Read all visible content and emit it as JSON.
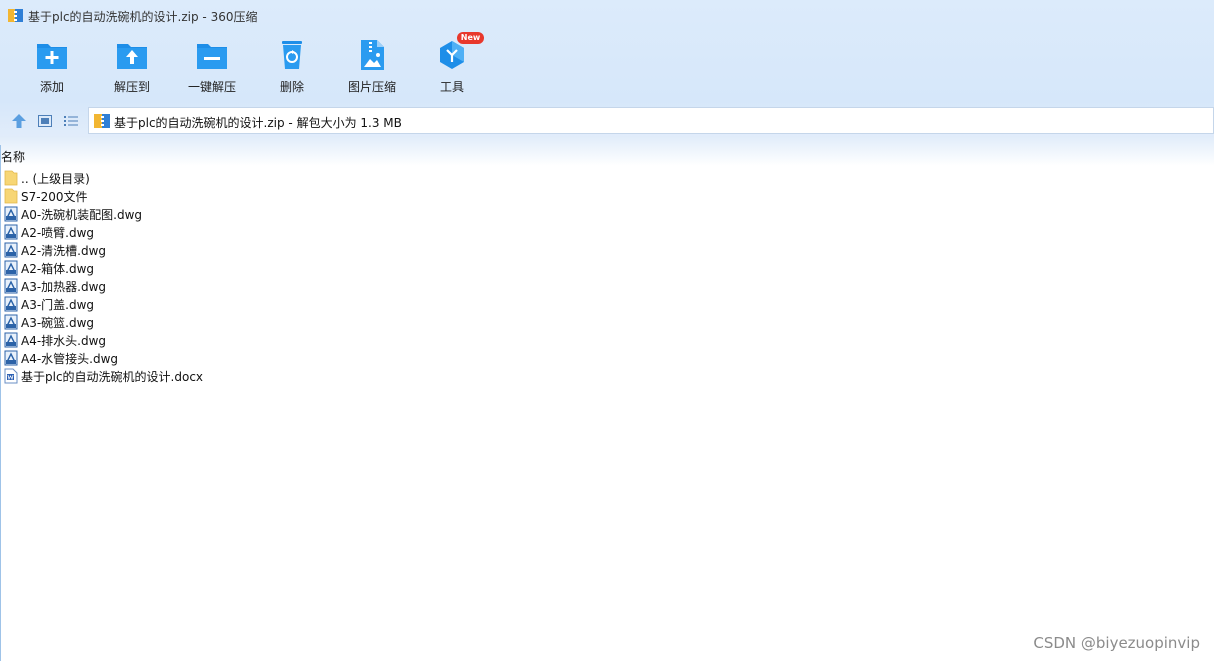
{
  "window": {
    "title": "基于plc的自动洗碗机的设计.zip - 360压缩"
  },
  "toolbar": {
    "buttons": [
      {
        "label": "添加",
        "icon": "add-folder-icon"
      },
      {
        "label": "解压到",
        "icon": "extract-to-icon"
      },
      {
        "label": "一键解压",
        "icon": "one-click-extract-icon"
      },
      {
        "label": "删除",
        "icon": "recycle-bin-icon"
      },
      {
        "label": "图片压缩",
        "icon": "image-compress-icon"
      },
      {
        "label": "工具",
        "icon": "tools-icon",
        "badge": "New"
      }
    ]
  },
  "navbar": {
    "address": "基于plc的自动洗碗机的设计.zip - 解包大小为 1.3 MB"
  },
  "list": {
    "column_name": "名称",
    "files": [
      {
        "name": ".. (上级目录)",
        "type": "folder"
      },
      {
        "name": "S7-200文件",
        "type": "folder"
      },
      {
        "name": "A0-洗碗机装配图.dwg",
        "type": "dwg"
      },
      {
        "name": "A2-喷臂.dwg",
        "type": "dwg"
      },
      {
        "name": "A2-清洗槽.dwg",
        "type": "dwg"
      },
      {
        "name": "A2-箱体.dwg",
        "type": "dwg"
      },
      {
        "name": "A3-加热器.dwg",
        "type": "dwg"
      },
      {
        "name": "A3-门盖.dwg",
        "type": "dwg"
      },
      {
        "name": "A3-碗篮.dwg",
        "type": "dwg"
      },
      {
        "name": "A4-排水头.dwg",
        "type": "dwg"
      },
      {
        "name": "A4-水管接头.dwg",
        "type": "dwg"
      },
      {
        "name": "基于plc的自动洗碗机的设计.docx",
        "type": "docx"
      }
    ]
  },
  "watermark": "CSDN @biyezuopinvip",
  "colors": {
    "accent": "#1e8ee8",
    "folder": "#f7d675",
    "badge": "#e8382c"
  }
}
